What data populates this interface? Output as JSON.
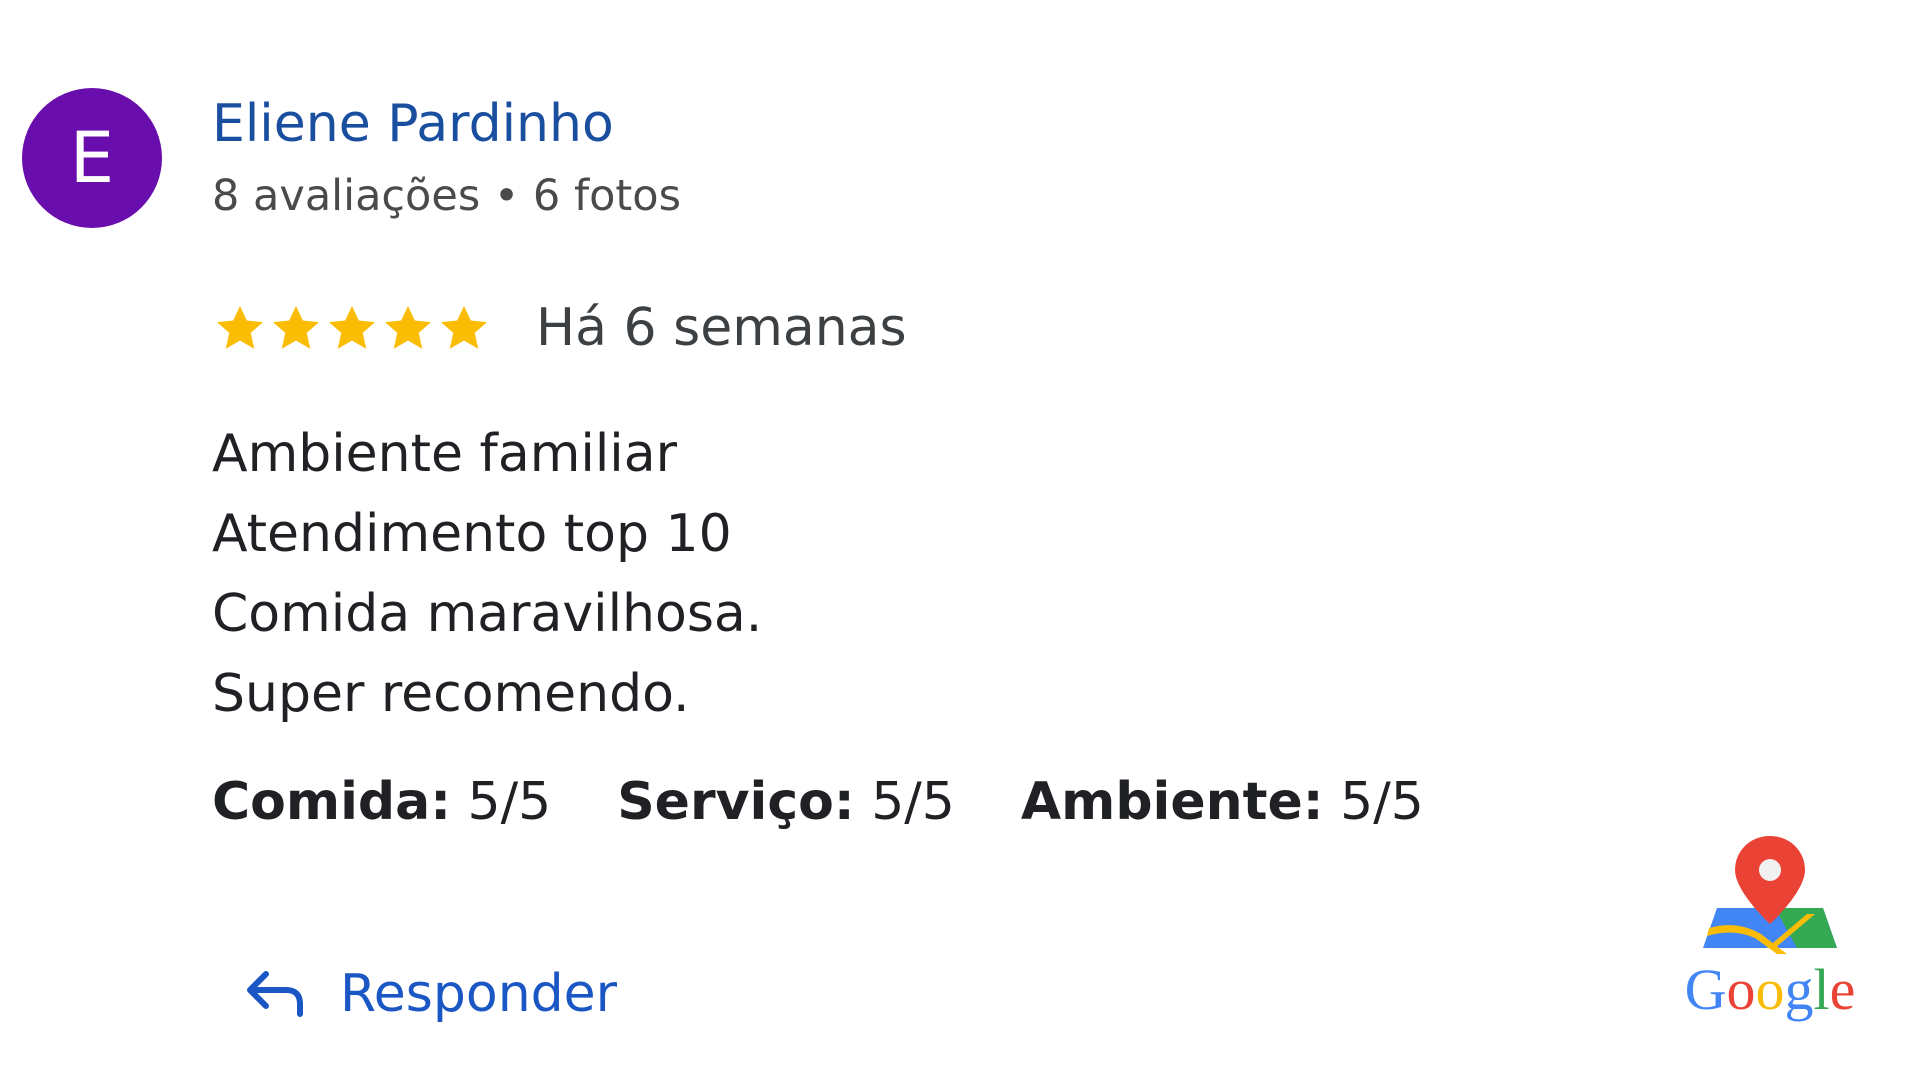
{
  "review": {
    "avatar_letter": "E",
    "reviewer_name": "Eliene Pardinho",
    "reviewer_meta": "8 avaliações • 6 fotos",
    "rating": 5,
    "rating_max": 5,
    "time_ago": "Há 6 semanas",
    "text_lines": [
      "Ambiente familiar",
      "Atendimento top 10",
      "Comida maravilhosa.",
      "Super recomendo."
    ],
    "attributes": [
      {
        "label": "Comida:",
        "value": "5/5"
      },
      {
        "label": "Serviço:",
        "value": "5/5"
      },
      {
        "label": "Ambiente:",
        "value": "5/5"
      }
    ]
  },
  "actions": {
    "reply_label": "Responder",
    "reply_icon": "reply-arrow-icon"
  },
  "branding": {
    "logo_icon": "google-maps-icon",
    "logo_text": "Google"
  },
  "colors": {
    "avatar_bg": "#6a0dad",
    "name_link": "#1a4fa0",
    "star_fill": "#fbbc04",
    "reply_blue": "#1a56c4",
    "google_blue": "#4285f4",
    "google_red": "#ea4335",
    "google_yellow": "#fbbc05",
    "google_green": "#34a853"
  }
}
